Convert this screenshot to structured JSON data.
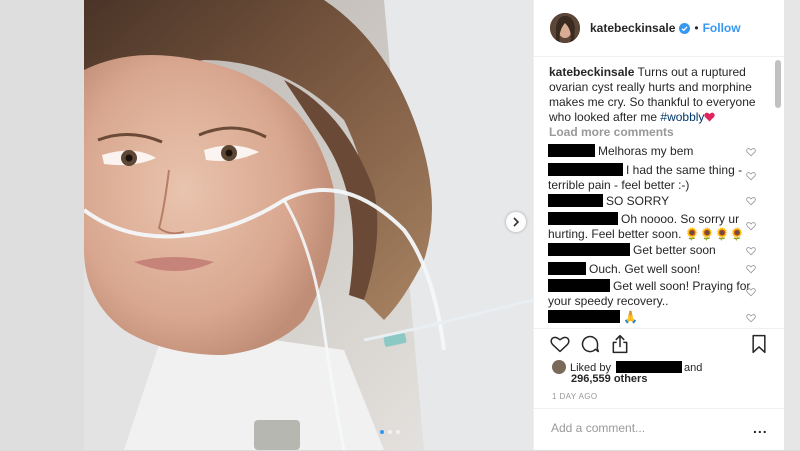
{
  "post": {
    "username": "katebeckinsale",
    "separator": "•",
    "follow_label": "Follow",
    "caption_user": "katebeckinsale",
    "caption_text": "Turns out a ruptured ovarian cyst really hurts and morphine makes me cry. So thankful to everyone who looked after me",
    "caption_tag": "#wobbly",
    "load_more": "Load more comments",
    "comments": [
      {
        "text": "Melhoras my bem"
      },
      {
        "text": "I had the same thing - terrible pain - feel better :-)"
      },
      {
        "text": "SO SORRY"
      },
      {
        "text": "Oh noooo. So sorry ur hurting. Feel better soon. 🌻🌻🌻🌻"
      },
      {
        "text": "Get better soon"
      },
      {
        "text": "Ouch. Get well soon!"
      },
      {
        "text": "Get well soon! Praying for your speedy recovery.."
      },
      {
        "text": "🙏"
      }
    ],
    "liked_by_prefix": "Liked by",
    "liked_by_suffix": "and",
    "likes_count": "296,559 others",
    "timestamp": "1 DAY AGO",
    "add_comment_placeholder": "Add a comment...",
    "more_options": "..."
  },
  "icons": {
    "verified": "verified-badge-icon",
    "heart_emoji": "red-heart-emoji",
    "like": "heart-outline-icon",
    "comment": "comment-bubble-icon",
    "share": "share-icon",
    "save": "bookmark-icon",
    "next": "chevron-right-icon"
  },
  "carousel": {
    "current": 1,
    "total": 3
  },
  "colors": {
    "accent": "#3897f0",
    "text": "#262626",
    "muted": "#999999",
    "hashtag": "#003569"
  }
}
